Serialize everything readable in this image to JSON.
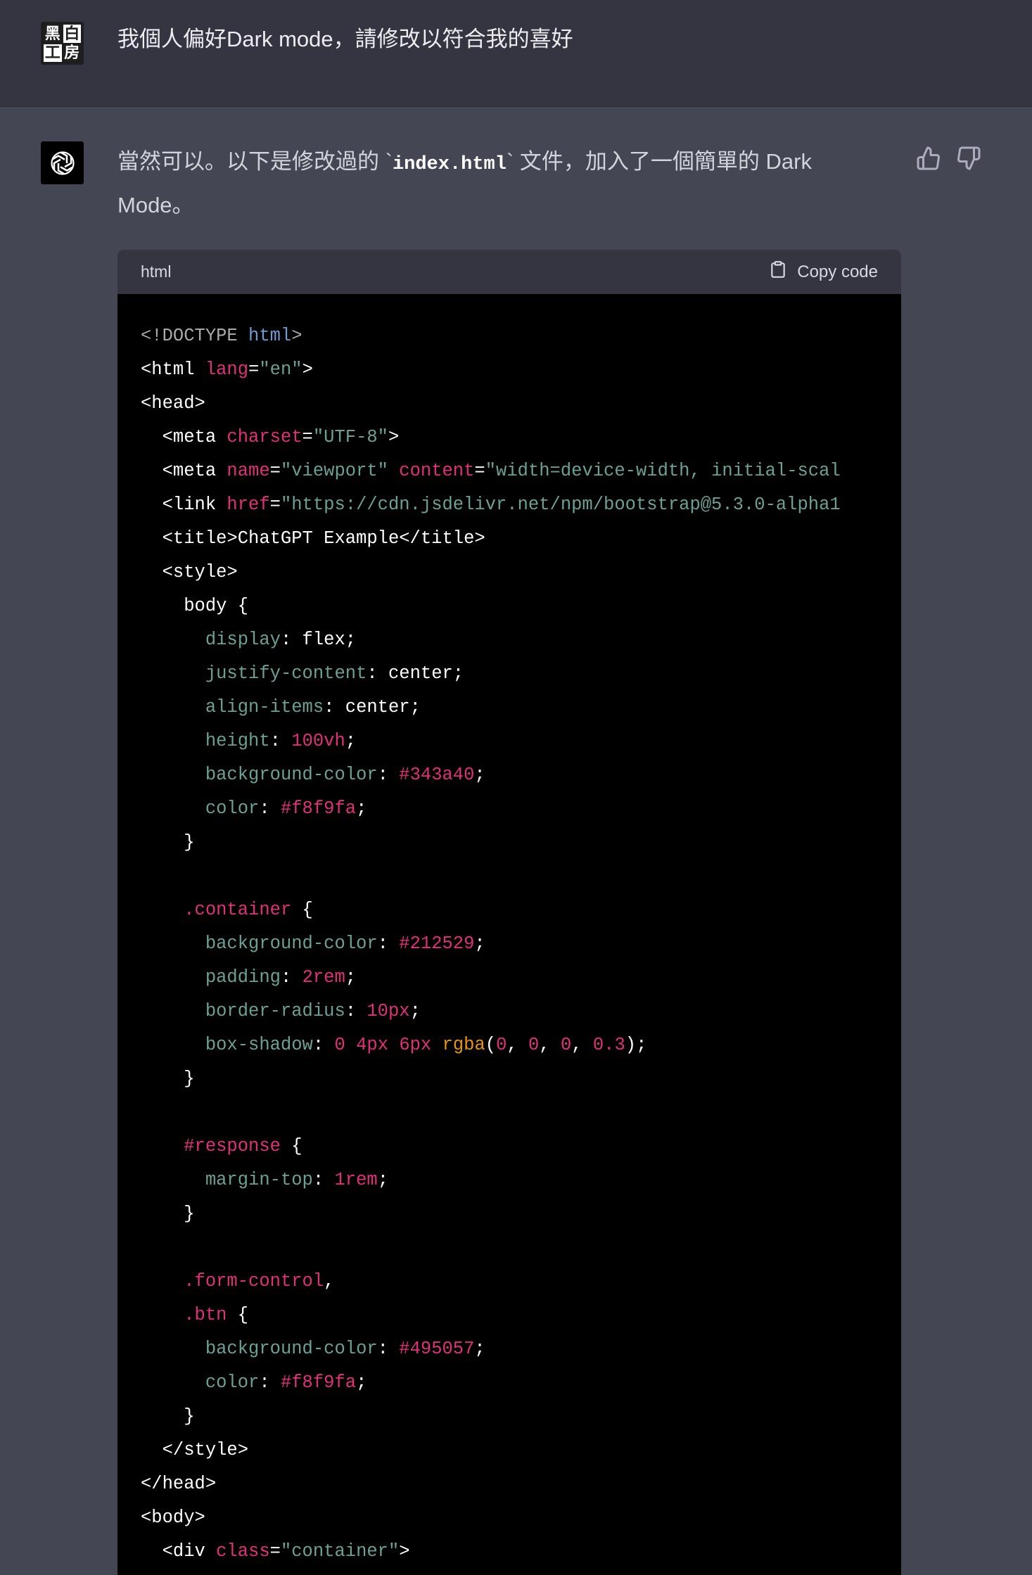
{
  "user_message": {
    "text": "我個人偏好Dark mode，請修改以符合我的喜好",
    "avatar_chars": [
      "黑",
      "白",
      "工",
      "房"
    ]
  },
  "assistant_message": {
    "text_before": "當然可以。以下是修改過的 `",
    "inline_code": "index.html",
    "text_after": "` 文件，加入了一個簡單的 Dark Mode。"
  },
  "code_block": {
    "language": "html",
    "copy_label": "Copy code",
    "lines": [
      [
        [
          "<!DOCTYPE ",
          "doctype"
        ],
        [
          "html",
          "kw"
        ],
        [
          ">",
          "doctype"
        ]
      ],
      [
        [
          "<html ",
          "plain"
        ],
        [
          "lang",
          "attr"
        ],
        [
          "=",
          "plain"
        ],
        [
          "\"en\"",
          "str"
        ],
        [
          ">",
          "plain"
        ]
      ],
      [
        [
          "<head>",
          "plain"
        ]
      ],
      [
        [
          "  <meta ",
          "plain"
        ],
        [
          "charset",
          "attr"
        ],
        [
          "=",
          "plain"
        ],
        [
          "\"UTF-8\"",
          "str"
        ],
        [
          ">",
          "plain"
        ]
      ],
      [
        [
          "  <meta ",
          "plain"
        ],
        [
          "name",
          "attr"
        ],
        [
          "=",
          "plain"
        ],
        [
          "\"viewport\"",
          "str"
        ],
        [
          " ",
          "plain"
        ],
        [
          "content",
          "attr"
        ],
        [
          "=",
          "plain"
        ],
        [
          "\"width=device-width, initial-scal",
          "str"
        ]
      ],
      [
        [
          "  <link ",
          "plain"
        ],
        [
          "href",
          "attr"
        ],
        [
          "=",
          "plain"
        ],
        [
          "\"https://cdn.jsdelivr.net/npm/bootstrap@5.3.0-alpha1",
          "str"
        ]
      ],
      [
        [
          "  <title>ChatGPT Example</title>",
          "plain"
        ]
      ],
      [
        [
          "  <style>",
          "plain"
        ]
      ],
      [
        [
          "    body {",
          "plain"
        ]
      ],
      [
        [
          "      ",
          "plain"
        ],
        [
          "display",
          "prop"
        ],
        [
          ": flex;",
          "plain"
        ]
      ],
      [
        [
          "      ",
          "plain"
        ],
        [
          "justify-content",
          "prop"
        ],
        [
          ": center;",
          "plain"
        ]
      ],
      [
        [
          "      ",
          "plain"
        ],
        [
          "align-items",
          "prop"
        ],
        [
          ": center;",
          "plain"
        ]
      ],
      [
        [
          "      ",
          "plain"
        ],
        [
          "height",
          "prop"
        ],
        [
          ": ",
          "plain"
        ],
        [
          "100vh",
          "num"
        ],
        [
          ";",
          "plain"
        ]
      ],
      [
        [
          "      ",
          "plain"
        ],
        [
          "background-color",
          "prop"
        ],
        [
          ": ",
          "plain"
        ],
        [
          "#343a40",
          "num"
        ],
        [
          ";",
          "plain"
        ]
      ],
      [
        [
          "      ",
          "plain"
        ],
        [
          "color",
          "prop"
        ],
        [
          ": ",
          "plain"
        ],
        [
          "#f8f9fa",
          "num"
        ],
        [
          ";",
          "plain"
        ]
      ],
      [
        [
          "    }",
          "plain"
        ]
      ],
      [
        [
          "",
          "plain"
        ]
      ],
      [
        [
          "    ",
          "plain"
        ],
        [
          ".container",
          "sel"
        ],
        [
          " {",
          "plain"
        ]
      ],
      [
        [
          "      ",
          "plain"
        ],
        [
          "background-color",
          "prop"
        ],
        [
          ": ",
          "plain"
        ],
        [
          "#212529",
          "num"
        ],
        [
          ";",
          "plain"
        ]
      ],
      [
        [
          "      ",
          "plain"
        ],
        [
          "padding",
          "prop"
        ],
        [
          ": ",
          "plain"
        ],
        [
          "2rem",
          "num"
        ],
        [
          ";",
          "plain"
        ]
      ],
      [
        [
          "      ",
          "plain"
        ],
        [
          "border-radius",
          "prop"
        ],
        [
          ": ",
          "plain"
        ],
        [
          "10px",
          "num"
        ],
        [
          ";",
          "plain"
        ]
      ],
      [
        [
          "      ",
          "plain"
        ],
        [
          "box-shadow",
          "prop"
        ],
        [
          ": ",
          "plain"
        ],
        [
          "0",
          "num"
        ],
        [
          " ",
          "plain"
        ],
        [
          "4px",
          "num"
        ],
        [
          " ",
          "plain"
        ],
        [
          "6px",
          "num"
        ],
        [
          " ",
          "plain"
        ],
        [
          "rgba",
          "fn"
        ],
        [
          "(",
          "plain"
        ],
        [
          "0",
          "num"
        ],
        [
          ", ",
          "plain"
        ],
        [
          "0",
          "num"
        ],
        [
          ", ",
          "plain"
        ],
        [
          "0",
          "num"
        ],
        [
          ", ",
          "plain"
        ],
        [
          "0.3",
          "num"
        ],
        [
          ");",
          "plain"
        ]
      ],
      [
        [
          "    }",
          "plain"
        ]
      ],
      [
        [
          "",
          "plain"
        ]
      ],
      [
        [
          "    ",
          "plain"
        ],
        [
          "#response",
          "sel"
        ],
        [
          " {",
          "plain"
        ]
      ],
      [
        [
          "      ",
          "plain"
        ],
        [
          "margin-top",
          "prop"
        ],
        [
          ": ",
          "plain"
        ],
        [
          "1rem",
          "num"
        ],
        [
          ";",
          "plain"
        ]
      ],
      [
        [
          "    }",
          "plain"
        ]
      ],
      [
        [
          "",
          "plain"
        ]
      ],
      [
        [
          "    ",
          "plain"
        ],
        [
          ".form-control",
          "sel"
        ],
        [
          ",",
          "plain"
        ]
      ],
      [
        [
          "    ",
          "plain"
        ],
        [
          ".btn",
          "sel"
        ],
        [
          " {",
          "plain"
        ]
      ],
      [
        [
          "      ",
          "plain"
        ],
        [
          "background-color",
          "prop"
        ],
        [
          ": ",
          "plain"
        ],
        [
          "#495057",
          "num"
        ],
        [
          ";",
          "plain"
        ]
      ],
      [
        [
          "      ",
          "plain"
        ],
        [
          "color",
          "prop"
        ],
        [
          ": ",
          "plain"
        ],
        [
          "#f8f9fa",
          "num"
        ],
        [
          ";",
          "plain"
        ]
      ],
      [
        [
          "    }",
          "plain"
        ]
      ],
      [
        [
          "  </style>",
          "plain"
        ]
      ],
      [
        [
          "</head>",
          "plain"
        ]
      ],
      [
        [
          "<body>",
          "plain"
        ]
      ],
      [
        [
          "  <div ",
          "plain"
        ],
        [
          "class",
          "attr"
        ],
        [
          "=",
          "plain"
        ],
        [
          "\"container\"",
          "str"
        ],
        [
          ">",
          "plain"
        ]
      ]
    ]
  },
  "icons": {
    "thumbs_up": "thumbs-up-icon",
    "thumbs_down": "thumbs-down-icon",
    "clipboard": "clipboard-icon",
    "openai_logo": "openai-logo-icon"
  },
  "colors": {
    "user_bg": "#343541",
    "assistant_bg": "#444654",
    "code_bg": "#000000",
    "attr": "#df3079",
    "string": "#6aa194",
    "keyword": "#6f9bd1",
    "function": "#e9950c"
  }
}
